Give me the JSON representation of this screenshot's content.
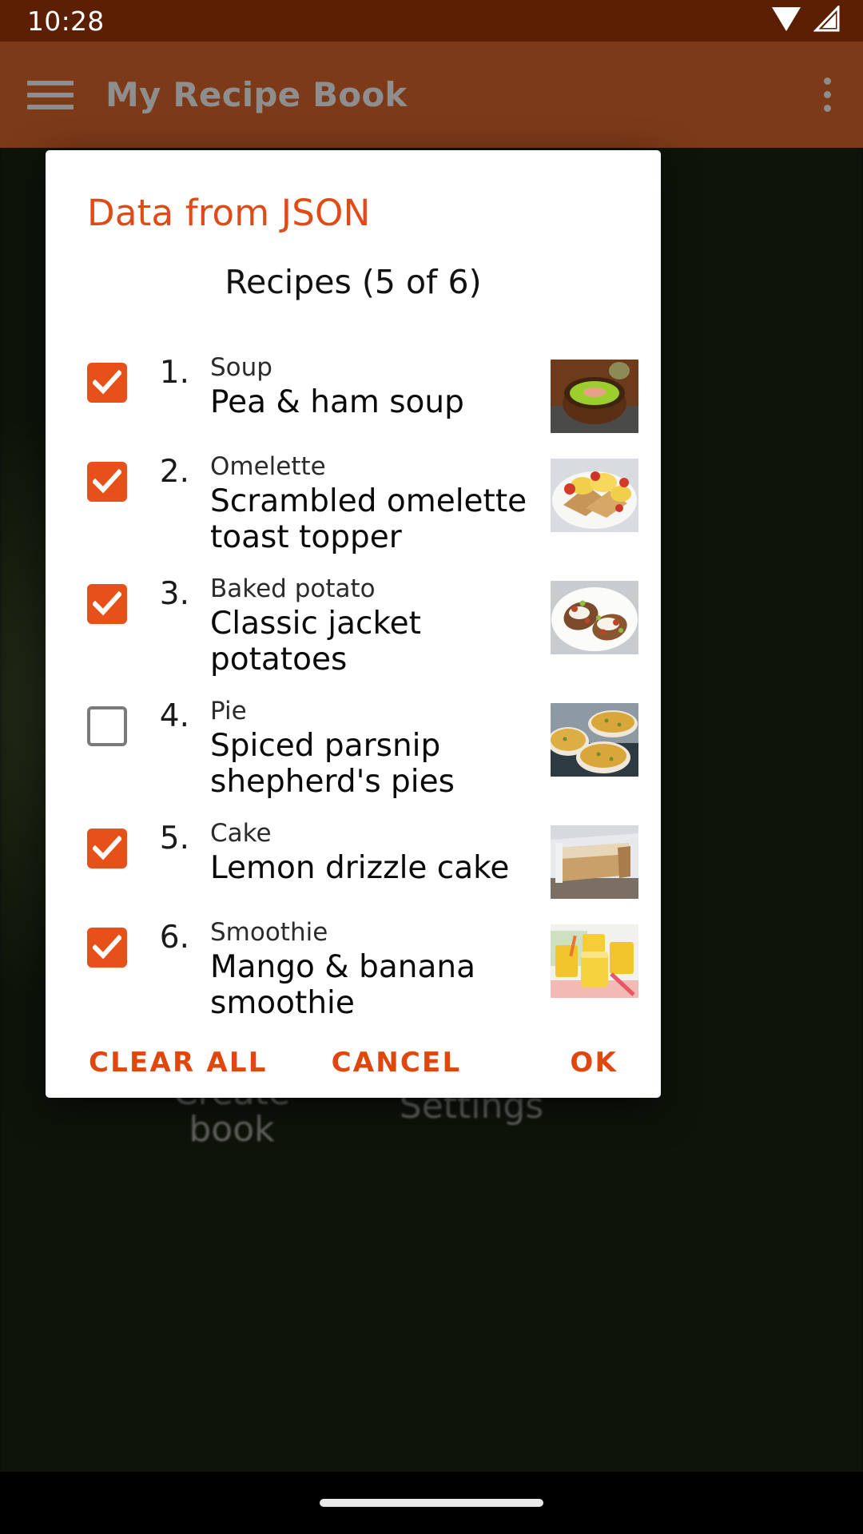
{
  "status_bar": {
    "time": "10:28",
    "icons": [
      "wifi-icon",
      "signal-icon"
    ]
  },
  "app_bar": {
    "menu_icon": "hamburger-menu-icon",
    "title": "My Recipe Book",
    "overflow_icon": "overflow-menu-icon"
  },
  "background": {
    "create_book_label": "Create book",
    "settings_label": "Settings"
  },
  "dialog": {
    "title": "Data from JSON",
    "list_title": "Recipes (5 of 6)",
    "accent_color": "#e04a17",
    "items": [
      {
        "index": "1.",
        "category": "Soup",
        "name": "Pea & ham soup",
        "checked": true,
        "thumb": "pea-ham-soup-thumbnail"
      },
      {
        "index": "2.",
        "category": "Omelette",
        "name": "Scrambled omelette toast topper",
        "checked": true,
        "thumb": "scrambled-omelette-toast-thumbnail"
      },
      {
        "index": "3.",
        "category": "Baked potato",
        "name": "Classic jacket potatoes",
        "checked": true,
        "thumb": "jacket-potatoes-thumbnail"
      },
      {
        "index": "4.",
        "category": "Pie",
        "name": "Spiced parsnip shepherd's pies",
        "checked": false,
        "thumb": "shepherds-pies-thumbnail"
      },
      {
        "index": "5.",
        "category": "Cake",
        "name": "Lemon drizzle cake",
        "checked": true,
        "thumb": "lemon-drizzle-cake-thumbnail"
      },
      {
        "index": "6.",
        "category": "Smoothie",
        "name": "Mango & banana smoothie",
        "checked": true,
        "thumb": "mango-banana-smoothie-thumbnail"
      }
    ],
    "actions": {
      "clear_all": "CLEAR ALL",
      "cancel": "CANCEL",
      "ok": "OK"
    }
  },
  "nav_bar": {
    "gesture_pill": "home-gesture-pill"
  }
}
